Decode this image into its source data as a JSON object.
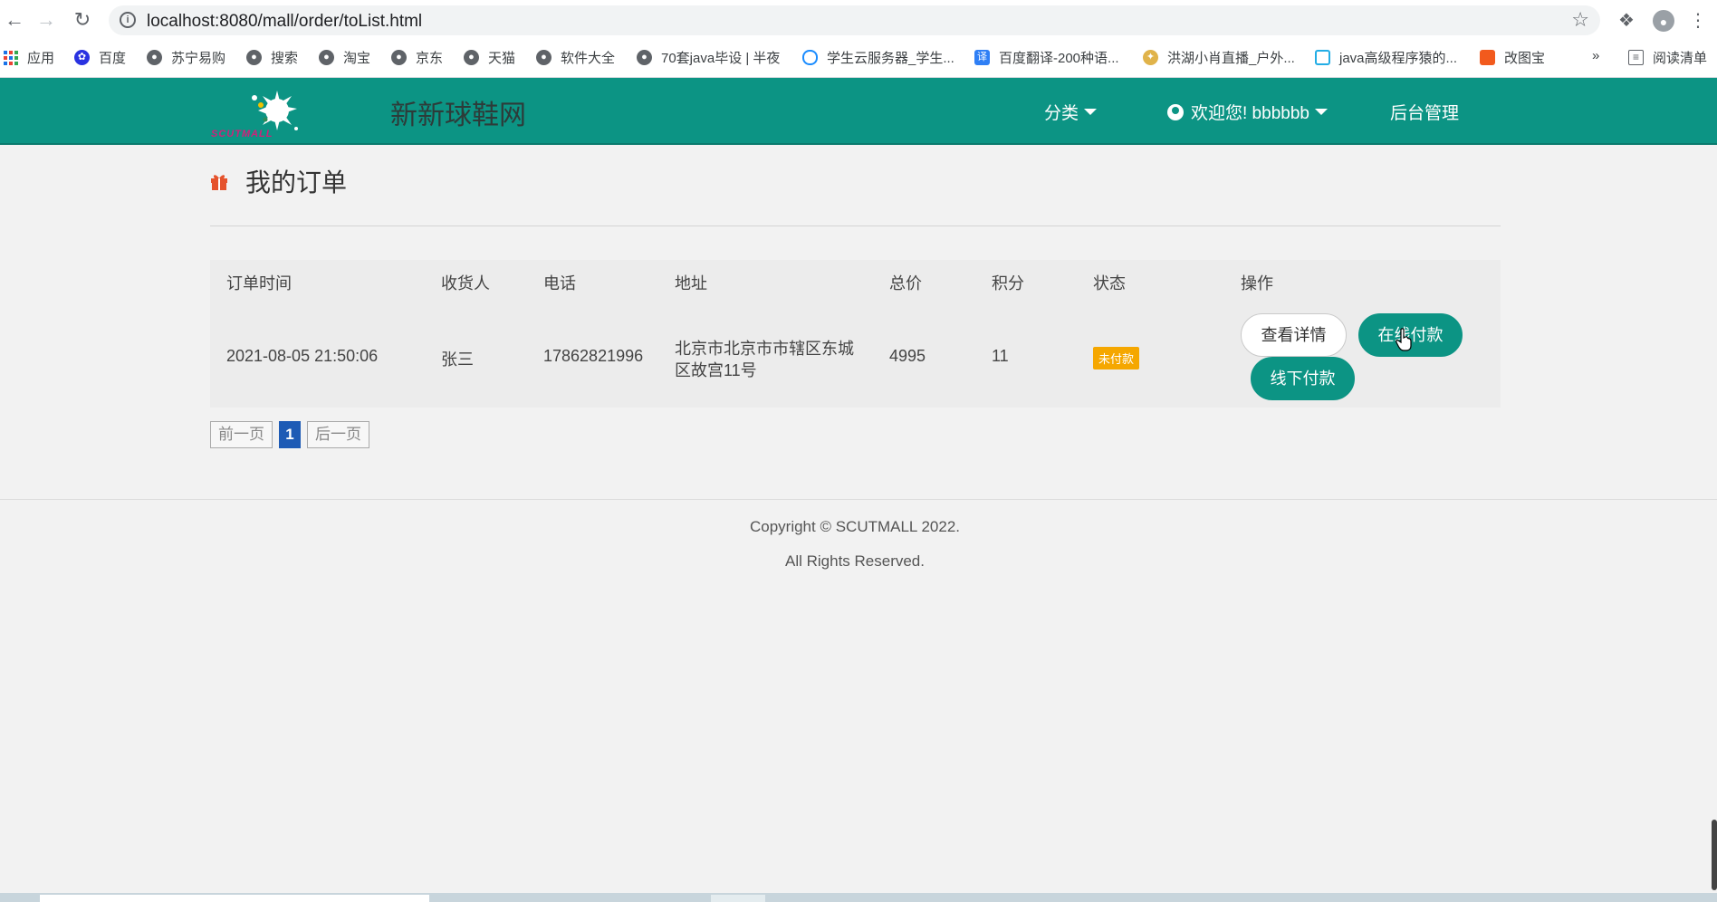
{
  "browser": {
    "url": "localhost:8080/mall/order/toList.html",
    "bookmarks": [
      {
        "label": "应用",
        "icon": "apps-grid-icon"
      },
      {
        "label": "百度",
        "icon": "baidu-paw-icon"
      },
      {
        "label": "苏宁易购",
        "icon": "globe-icon"
      },
      {
        "label": "搜索",
        "icon": "globe-icon"
      },
      {
        "label": "淘宝",
        "icon": "globe-icon"
      },
      {
        "label": "京东",
        "icon": "globe-icon"
      },
      {
        "label": "天猫",
        "icon": "globe-icon"
      },
      {
        "label": "软件大全",
        "icon": "globe-icon"
      },
      {
        "label": "70套java毕设 | 半夜",
        "icon": "globe-icon"
      },
      {
        "label": "学生云服务器_学生...",
        "icon": "cloud-icon"
      },
      {
        "label": "百度翻译-200种语...",
        "icon": "translate-icon"
      },
      {
        "label": "洪湖小肖直播_户外...",
        "icon": "bird-icon"
      },
      {
        "label": "java高级程序猿的...",
        "icon": "tv-icon"
      },
      {
        "label": "改图宝",
        "icon": "image-edit-icon"
      }
    ],
    "more_bookmarks": "»",
    "reading_list": "阅读清单"
  },
  "header": {
    "logo_text": "SCUTMALL",
    "site_name": "新新球鞋网",
    "nav": {
      "category": "分类",
      "welcome": "欢迎您! bbbbbb",
      "admin": "后台管理"
    }
  },
  "main": {
    "title": "我的订单",
    "table": {
      "headers": [
        "订单时间",
        "收货人",
        "电话",
        "地址",
        "总价",
        "积分",
        "状态",
        "操作"
      ],
      "rows": [
        {
          "time": "2021-08-05 21:50:06",
          "receiver": "张三",
          "phone": "17862821996",
          "address_line1": "北京市北京市市辖区东城",
          "address_line2": "区故宫11号",
          "total": "4995",
          "points": "11",
          "status": "未付款",
          "actions": {
            "details": "查看详情",
            "pay_online": "在线付款",
            "pay_offline": "线下付款"
          }
        }
      ]
    },
    "pagination": {
      "prev": "前一页",
      "current": "1",
      "next": "后一页"
    }
  },
  "footer": {
    "copyright": "Copyright © SCUTMALL 2022.",
    "rights": "All Rights Reserved."
  },
  "colors": {
    "brand": "#0c9484",
    "status_unpaid": "#f5a700",
    "page_current": "#1e5bb5",
    "gift_icon": "#e5532d"
  }
}
